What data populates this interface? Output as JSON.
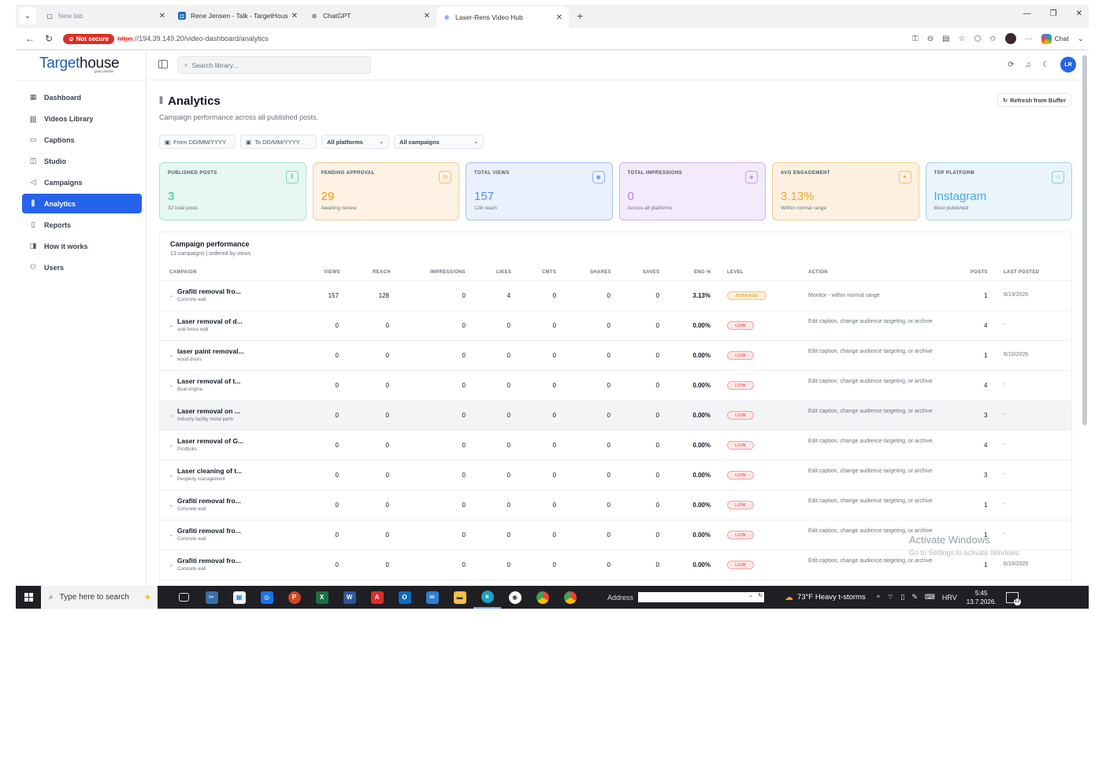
{
  "browser": {
    "tabs": [
      {
        "title": "New tab",
        "state": "dim"
      },
      {
        "title": "Rene Jensen - Talk - TargetHouse",
        "state": "normal"
      },
      {
        "title": "ChatGPT",
        "state": "normal"
      },
      {
        "title": "Laser-Rens Video Hub",
        "state": "active"
      }
    ],
    "not_secure_label": "Not secure",
    "url_proto": "https",
    "url_rest": "://194.39.149.20/video-dashboard/analytics",
    "chat_label": "Chat"
  },
  "app": {
    "logo_main": "Target",
    "logo_house": "house",
    "logo_sub": "goal catcher",
    "search_placeholder": "Search library...",
    "user_initials": "LR",
    "nav": [
      {
        "label": "Dashboard",
        "icon": "grid-icon"
      },
      {
        "label": "Videos Library",
        "icon": "library-icon"
      },
      {
        "label": "Captions",
        "icon": "captions-icon"
      },
      {
        "label": "Studio",
        "icon": "studio-icon"
      },
      {
        "label": "Campaigns",
        "icon": "megaphone-icon"
      },
      {
        "label": "Analytics",
        "icon": "bar-chart-icon",
        "active": true
      },
      {
        "label": "Reports",
        "icon": "file-icon"
      },
      {
        "label": "How it works",
        "icon": "book-icon"
      },
      {
        "label": "Users",
        "icon": "users-icon"
      }
    ]
  },
  "page": {
    "title": "Analytics",
    "subtitle": "Campaign performance across all published posts.",
    "refresh_label": "Refresh from Buffer",
    "filters": {
      "from_placeholder": "From  DD/MM/YYYY",
      "to_placeholder": "To  DD/MM/YYYY",
      "platform": "All platforms",
      "campaign": "All campaigns"
    }
  },
  "cards": [
    {
      "label": "PUBLISHED POSTS",
      "value": "3",
      "sub": "32 total posts",
      "color": "green"
    },
    {
      "label": "PENDING APPROVAL",
      "value": "29",
      "sub": "Awaiting review",
      "color": "orange"
    },
    {
      "label": "TOTAL VIEWS",
      "value": "157",
      "sub": "128 reach",
      "color": "blue"
    },
    {
      "label": "TOTAL IMPRESSIONS",
      "value": "0",
      "sub": "Across all platforms",
      "color": "purple"
    },
    {
      "label": "AVG ENGAGEMENT",
      "value": "3.13%",
      "sub": "Within normal range",
      "color": "amber"
    },
    {
      "label": "TOP PLATFORM",
      "value": "Instagram",
      "sub": "Most published",
      "color": "cyan"
    }
  ],
  "performance": {
    "title": "Campaign performance",
    "subtitle": "13 campaigns | ordered by views",
    "columns": [
      "CAMPAIGN",
      "VIEWS",
      "REACH",
      "IMPRESSIONS",
      "LIKES",
      "CMTS",
      "SHARES",
      "SAVES",
      "ENG %",
      "LEVEL",
      "ACTION",
      "POSTS",
      "LAST POSTED"
    ],
    "rows": [
      {
        "name": "Grafiti removal fro...",
        "sub": "Concrete wall",
        "views": "157",
        "reach": "128",
        "impressions": "0",
        "likes": "4",
        "cmts": "0",
        "shares": "0",
        "saves": "0",
        "eng": "3.13%",
        "level": "AVERAGE",
        "action": "Monitor - within normal range",
        "posts": "1",
        "last": "6/13/2026"
      },
      {
        "name": "Laser removal of d...",
        "sub": "side fence wall",
        "views": "0",
        "reach": "0",
        "impressions": "0",
        "likes": "0",
        "cmts": "0",
        "shares": "0",
        "saves": "0",
        "eng": "0.00%",
        "level": "LOW",
        "action": "Edit caption, change audience targeting, or archive",
        "posts": "4",
        "last": "-"
      },
      {
        "name": "laser paint removal...",
        "sub": "wood doors",
        "views": "0",
        "reach": "0",
        "impressions": "0",
        "likes": "0",
        "cmts": "0",
        "shares": "0",
        "saves": "0",
        "eng": "0.00%",
        "level": "LOW",
        "action": "Edit caption, change audience targeting, or archive",
        "posts": "1",
        "last": "6/10/2026"
      },
      {
        "name": "Laser removal of t...",
        "sub": "Boat engine",
        "views": "0",
        "reach": "0",
        "impressions": "0",
        "likes": "0",
        "cmts": "0",
        "shares": "0",
        "saves": "0",
        "eng": "0.00%",
        "level": "LOW",
        "action": "Edit caption, change audience targeting, or archive",
        "posts": "4",
        "last": "-"
      },
      {
        "name": "Laser removal on ...",
        "sub": "Industry facility metal parts",
        "views": "0",
        "reach": "0",
        "impressions": "0",
        "likes": "0",
        "cmts": "0",
        "shares": "0",
        "saves": "0",
        "eng": "0.00%",
        "level": "LOW",
        "action": "Edit caption, change audience targeting, or archive",
        "posts": "3",
        "last": "-",
        "highlight": true
      },
      {
        "name": "Laser removal of G...",
        "sub": "Postboks",
        "views": "0",
        "reach": "0",
        "impressions": "0",
        "likes": "0",
        "cmts": "0",
        "shares": "0",
        "saves": "0",
        "eng": "0.00%",
        "level": "LOW",
        "action": "Edit caption, change audience targeting, or archive",
        "posts": "4",
        "last": "-"
      },
      {
        "name": "Laser cleaning of t...",
        "sub": "Peoperty management",
        "views": "0",
        "reach": "0",
        "impressions": "0",
        "likes": "0",
        "cmts": "0",
        "shares": "0",
        "saves": "0",
        "eng": "0.00%",
        "level": "LOW",
        "action": "Edit caption, change audience targeting, or archive",
        "posts": "3",
        "last": "-"
      },
      {
        "name": "Grafiti removal fro...",
        "sub": "Concrete wall",
        "views": "0",
        "reach": "0",
        "impressions": "0",
        "likes": "0",
        "cmts": "0",
        "shares": "0",
        "saves": "0",
        "eng": "0.00%",
        "level": "LOW",
        "action": "Edit caption, change audience targeting, or archive",
        "posts": "1",
        "last": "-"
      },
      {
        "name": "Grafiti removal fro...",
        "sub": "Concrete wall",
        "views": "0",
        "reach": "0",
        "impressions": "0",
        "likes": "0",
        "cmts": "0",
        "shares": "0",
        "saves": "0",
        "eng": "0.00%",
        "level": "LOW",
        "action": "Edit caption, change audience targeting, or archive",
        "posts": "1",
        "last": "-"
      },
      {
        "name": "Grafiti removal fro...",
        "sub": "Concrete wall",
        "views": "0",
        "reach": "0",
        "impressions": "0",
        "likes": "0",
        "cmts": "0",
        "shares": "0",
        "saves": "0",
        "eng": "0.00%",
        "level": "LOW",
        "action": "Edit caption, change audience targeting, or archive",
        "posts": "1",
        "last": "6/10/2026"
      }
    ]
  },
  "watermark": {
    "title": "Activate Windows",
    "sub": "Go to Settings to activate Windows."
  },
  "taskbar": {
    "search_placeholder": "Type here to search",
    "address_label": "Address",
    "weather": "73°F  Heavy t-storms",
    "lang": "HRV",
    "time": "5:45",
    "date": "13.7.2026.",
    "notif_count": "13"
  }
}
